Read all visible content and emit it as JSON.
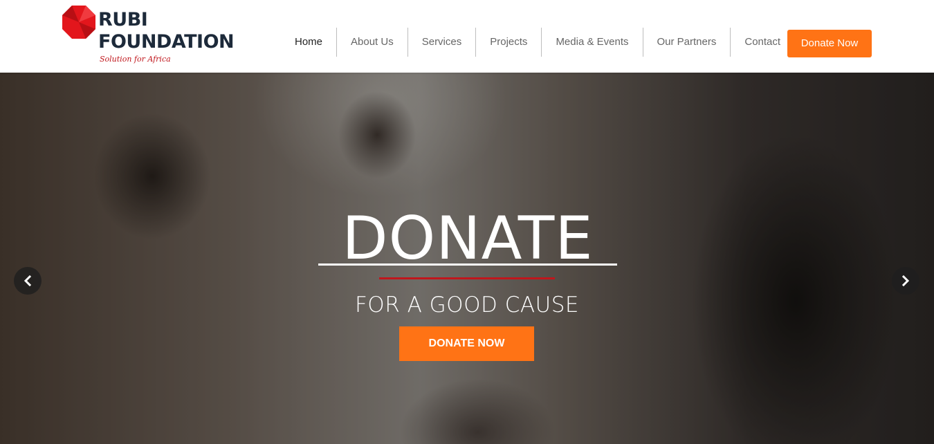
{
  "brand": {
    "line1": "RUBI",
    "line2": "FOUNDATION",
    "tagline": "Solution for Africa",
    "logo_color": "#e3161c"
  },
  "nav": {
    "items": [
      {
        "label": "Home",
        "active": true
      },
      {
        "label": "About Us"
      },
      {
        "label": "Services"
      },
      {
        "label": "Projects"
      },
      {
        "label": "Media & Events"
      },
      {
        "label": "Our Partners"
      },
      {
        "label": "Contact"
      }
    ],
    "donate_label": "Donate Now",
    "accent": "#ff7315"
  },
  "hero": {
    "title": "DONATE",
    "subtitle": "FOR A GOOD CAUSE",
    "cta_label": "DONATE NOW",
    "prev_icon": "chevron-left-icon",
    "next_icon": "chevron-right-icon",
    "divider_color": "#c0161c"
  }
}
